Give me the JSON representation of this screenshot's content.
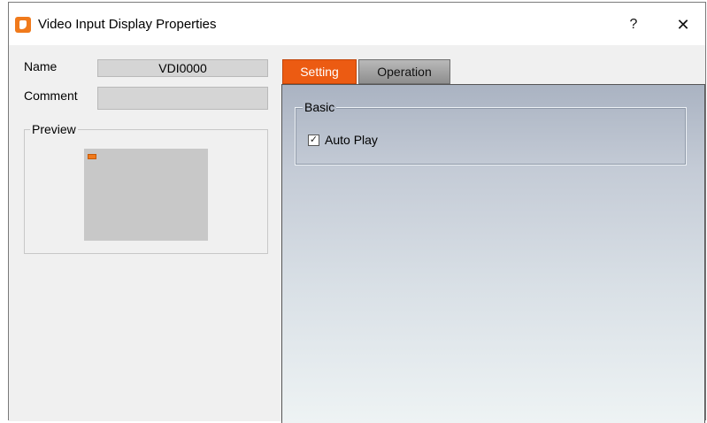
{
  "window": {
    "title": "Video Input Display Properties",
    "help_glyph": "?",
    "close_glyph": "✕"
  },
  "left": {
    "name_label": "Name",
    "name_value": "VDI0000",
    "comment_label": "Comment",
    "comment_value": "",
    "preview_label": "Preview"
  },
  "tabs": [
    {
      "label": "Setting",
      "active": true
    },
    {
      "label": "Operation",
      "active": false
    }
  ],
  "setting": {
    "group_label": "Basic",
    "auto_play_label": "Auto Play",
    "auto_play_checked": true,
    "check_glyph": "✓"
  },
  "colors": {
    "accent": "#ec5b12",
    "panel_top": "#aab3c2",
    "panel_bottom": "#eef3f4"
  }
}
